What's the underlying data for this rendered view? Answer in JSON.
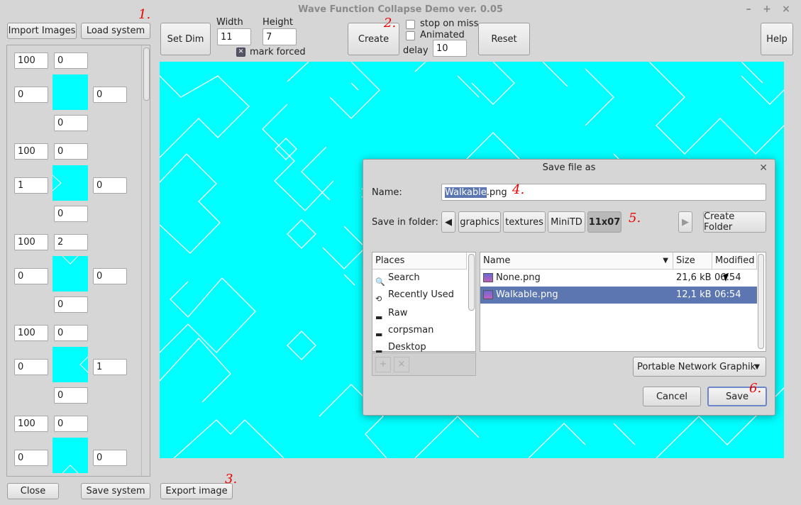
{
  "window": {
    "title": "Wave Function Collapse Demo ver. 0.05"
  },
  "toolbar": {
    "import_images": "Import Images",
    "load_system": "Load system",
    "set_dim": "Set Dim",
    "width_label": "Width",
    "width_value": "11",
    "height_label": "Height",
    "height_value": "7",
    "mark_forced": "mark forced",
    "create": "Create",
    "stop_on_miss": "stop on miss",
    "animated": "Animated",
    "delay_label": "delay",
    "delay_value": "10",
    "reset": "Reset",
    "help": "Help"
  },
  "tiles": [
    {
      "top": "100",
      "right_top": "0",
      "left": "0",
      "right": "0",
      "bottom": "0"
    },
    {
      "top": "100",
      "right_top": "0",
      "left": "1",
      "right": "0",
      "bottom": "0"
    },
    {
      "top": "100",
      "right_top": "2",
      "left": "0",
      "right": "0",
      "bottom": "0"
    },
    {
      "top": "100",
      "right_top": "0",
      "left": "0",
      "right": "1",
      "bottom": "0"
    },
    {
      "top": "100",
      "right_top": "0",
      "left": "0",
      "right": "0",
      "bottom": ""
    }
  ],
  "bottom": {
    "close": "Close",
    "save_system": "Save system",
    "export_image": "Export image"
  },
  "annotations": {
    "a1": "1.",
    "a2": "2.",
    "a3": "3.",
    "a4": "4.",
    "a5": "5.",
    "a6": "6."
  },
  "dialog": {
    "title": "Save file as",
    "name_label": "Name:",
    "name_value_selected": "Walkable",
    "name_value_rest": ".png",
    "folder_label": "Save in folder:",
    "crumbs": [
      "graphics",
      "textures",
      "MiniTD",
      "11x07"
    ],
    "create_folder": "Create Folder",
    "places_header": "Places",
    "places": [
      "Search",
      "Recently Used",
      "Raw",
      "corpsman",
      "Desktop"
    ],
    "col_name": "Name",
    "col_size": "Size",
    "col_modified": "Modified",
    "files": [
      {
        "name": "None.png",
        "size": "21,6 kB",
        "modified": "06:54"
      },
      {
        "name": "Walkable.png",
        "size": "12,1 kB",
        "modified": "06:54"
      }
    ],
    "filter": "Portable Network Graphik",
    "cancel": "Cancel",
    "save": "Save"
  },
  "colors": {
    "canvas": "#00ffff",
    "selection": "#5b76b0",
    "annotation": "#e00000"
  }
}
